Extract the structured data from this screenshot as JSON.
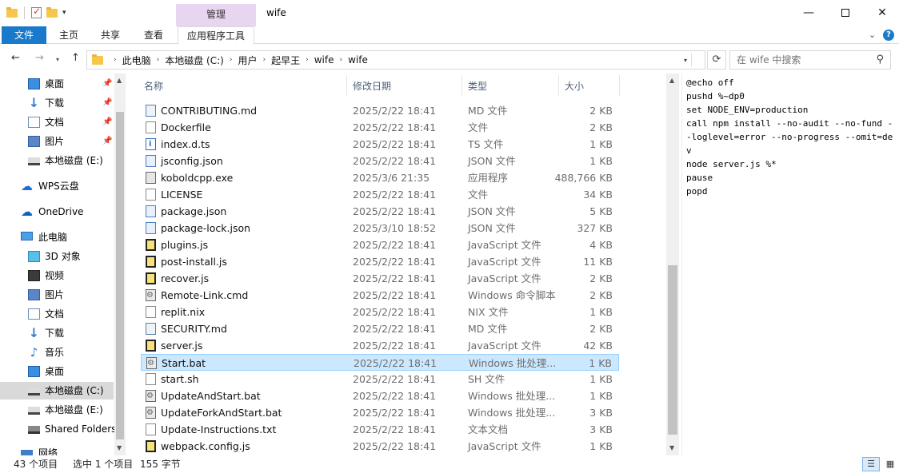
{
  "window": {
    "title": "wife",
    "context_tab": "管理",
    "minimize": "—",
    "close": "✕"
  },
  "ribbon": {
    "tabs": [
      "文件",
      "主页",
      "共享",
      "查看",
      "应用程序工具"
    ]
  },
  "address": {
    "crumbs": [
      "此电脑",
      "本地磁盘 (C:)",
      "用户",
      "起早王",
      "wife",
      "wife"
    ],
    "search_placeholder": "在 wife 中搜索"
  },
  "nav": {
    "items": [
      {
        "label": "桌面",
        "icon": "desktop-icon",
        "pinned": true
      },
      {
        "label": "下载",
        "icon": "download-icon",
        "pinned": true
      },
      {
        "label": "文档",
        "icon": "document-icon",
        "pinned": true
      },
      {
        "label": "图片",
        "icon": "pictures-icon",
        "pinned": true
      },
      {
        "label": "本地磁盘 (E:)",
        "icon": "drive-icon",
        "pinned": false
      },
      {
        "label": "WPS云盘",
        "icon": "wps-cloud-icon",
        "pinned": false
      },
      {
        "label": "OneDrive",
        "icon": "onedrive-icon",
        "pinned": false
      },
      {
        "label": "此电脑",
        "icon": "this-pc-icon",
        "pinned": false
      },
      {
        "label": "3D 对象",
        "icon": "3d-objects-icon",
        "pinned": false
      },
      {
        "label": "视频",
        "icon": "videos-icon",
        "pinned": false
      },
      {
        "label": "图片",
        "icon": "pictures-icon",
        "pinned": false
      },
      {
        "label": "文档",
        "icon": "document-icon",
        "pinned": false
      },
      {
        "label": "下载",
        "icon": "download-icon",
        "pinned": false
      },
      {
        "label": "音乐",
        "icon": "music-icon",
        "pinned": false
      },
      {
        "label": "桌面",
        "icon": "desktop-icon",
        "pinned": false
      },
      {
        "label": "本地磁盘 (C:)",
        "icon": "drive-icon",
        "pinned": false
      },
      {
        "label": "本地磁盘 (E:)",
        "icon": "drive-icon",
        "pinned": false
      },
      {
        "label": "Shared Folders",
        "icon": "shared-folder-icon",
        "pinned": false
      },
      {
        "label": "网络",
        "icon": "network-icon",
        "pinned": false
      }
    ]
  },
  "columns": {
    "name": "名称",
    "date": "修改日期",
    "type": "类型",
    "size": "大小"
  },
  "files": [
    {
      "name": "CONTRIBUTING.md",
      "date": "2025/2/22 18:41",
      "type": "MD 文件",
      "size": "2 KB",
      "kind": "md"
    },
    {
      "name": "Dockerfile",
      "date": "2025/2/22 18:41",
      "type": "文件",
      "size": "2 KB",
      "kind": "blank"
    },
    {
      "name": "index.d.ts",
      "date": "2025/2/22 18:41",
      "type": "TS 文件",
      "size": "1 KB",
      "kind": "ts"
    },
    {
      "name": "jsconfig.json",
      "date": "2025/2/22 18:41",
      "type": "JSON 文件",
      "size": "1 KB",
      "kind": "json"
    },
    {
      "name": "koboldcpp.exe",
      "date": "2025/3/6 21:35",
      "type": "应用程序",
      "size": "488,766 KB",
      "kind": "exe"
    },
    {
      "name": "LICENSE",
      "date": "2025/2/22 18:41",
      "type": "文件",
      "size": "34 KB",
      "kind": "blank"
    },
    {
      "name": "package.json",
      "date": "2025/2/22 18:41",
      "type": "JSON 文件",
      "size": "5 KB",
      "kind": "json"
    },
    {
      "name": "package-lock.json",
      "date": "2025/3/10 18:52",
      "type": "JSON 文件",
      "size": "327 KB",
      "kind": "json"
    },
    {
      "name": "plugins.js",
      "date": "2025/2/22 18:41",
      "type": "JavaScript 文件",
      "size": "4 KB",
      "kind": "js"
    },
    {
      "name": "post-install.js",
      "date": "2025/2/22 18:41",
      "type": "JavaScript 文件",
      "size": "11 KB",
      "kind": "js"
    },
    {
      "name": "recover.js",
      "date": "2025/2/22 18:41",
      "type": "JavaScript 文件",
      "size": "2 KB",
      "kind": "js"
    },
    {
      "name": "Remote-Link.cmd",
      "date": "2025/2/22 18:41",
      "type": "Windows 命令脚本",
      "size": "2 KB",
      "kind": "bat"
    },
    {
      "name": "replit.nix",
      "date": "2025/2/22 18:41",
      "type": "NIX 文件",
      "size": "1 KB",
      "kind": "blank"
    },
    {
      "name": "SECURITY.md",
      "date": "2025/2/22 18:41",
      "type": "MD 文件",
      "size": "2 KB",
      "kind": "md"
    },
    {
      "name": "server.js",
      "date": "2025/2/22 18:41",
      "type": "JavaScript 文件",
      "size": "42 KB",
      "kind": "js"
    },
    {
      "name": "Start.bat",
      "date": "2025/2/22 18:41",
      "type": "Windows 批处理...",
      "size": "1 KB",
      "kind": "bat",
      "selected": true
    },
    {
      "name": "start.sh",
      "date": "2025/2/22 18:41",
      "type": "SH 文件",
      "size": "1 KB",
      "kind": "blank"
    },
    {
      "name": "UpdateAndStart.bat",
      "date": "2025/2/22 18:41",
      "type": "Windows 批处理...",
      "size": "1 KB",
      "kind": "bat"
    },
    {
      "name": "UpdateForkAndStart.bat",
      "date": "2025/2/22 18:41",
      "type": "Windows 批处理...",
      "size": "3 KB",
      "kind": "bat"
    },
    {
      "name": "Update-Instructions.txt",
      "date": "2025/2/22 18:41",
      "type": "文本文档",
      "size": "3 KB",
      "kind": "blank"
    },
    {
      "name": "webpack.config.js",
      "date": "2025/2/22 18:41",
      "type": "JavaScript 文件",
      "size": "1 KB",
      "kind": "js"
    }
  ],
  "preview": {
    "text": "@echo off\npushd %~dp0\nset NODE_ENV=production\ncall npm install --no-audit --no-fund --loglevel=error --no-progress --omit=dev\nnode server.js %*\npause\npopd"
  },
  "status": {
    "item_count": "43 个项目",
    "selection": "选中 1 个项目",
    "selection_size": "155 字节"
  }
}
